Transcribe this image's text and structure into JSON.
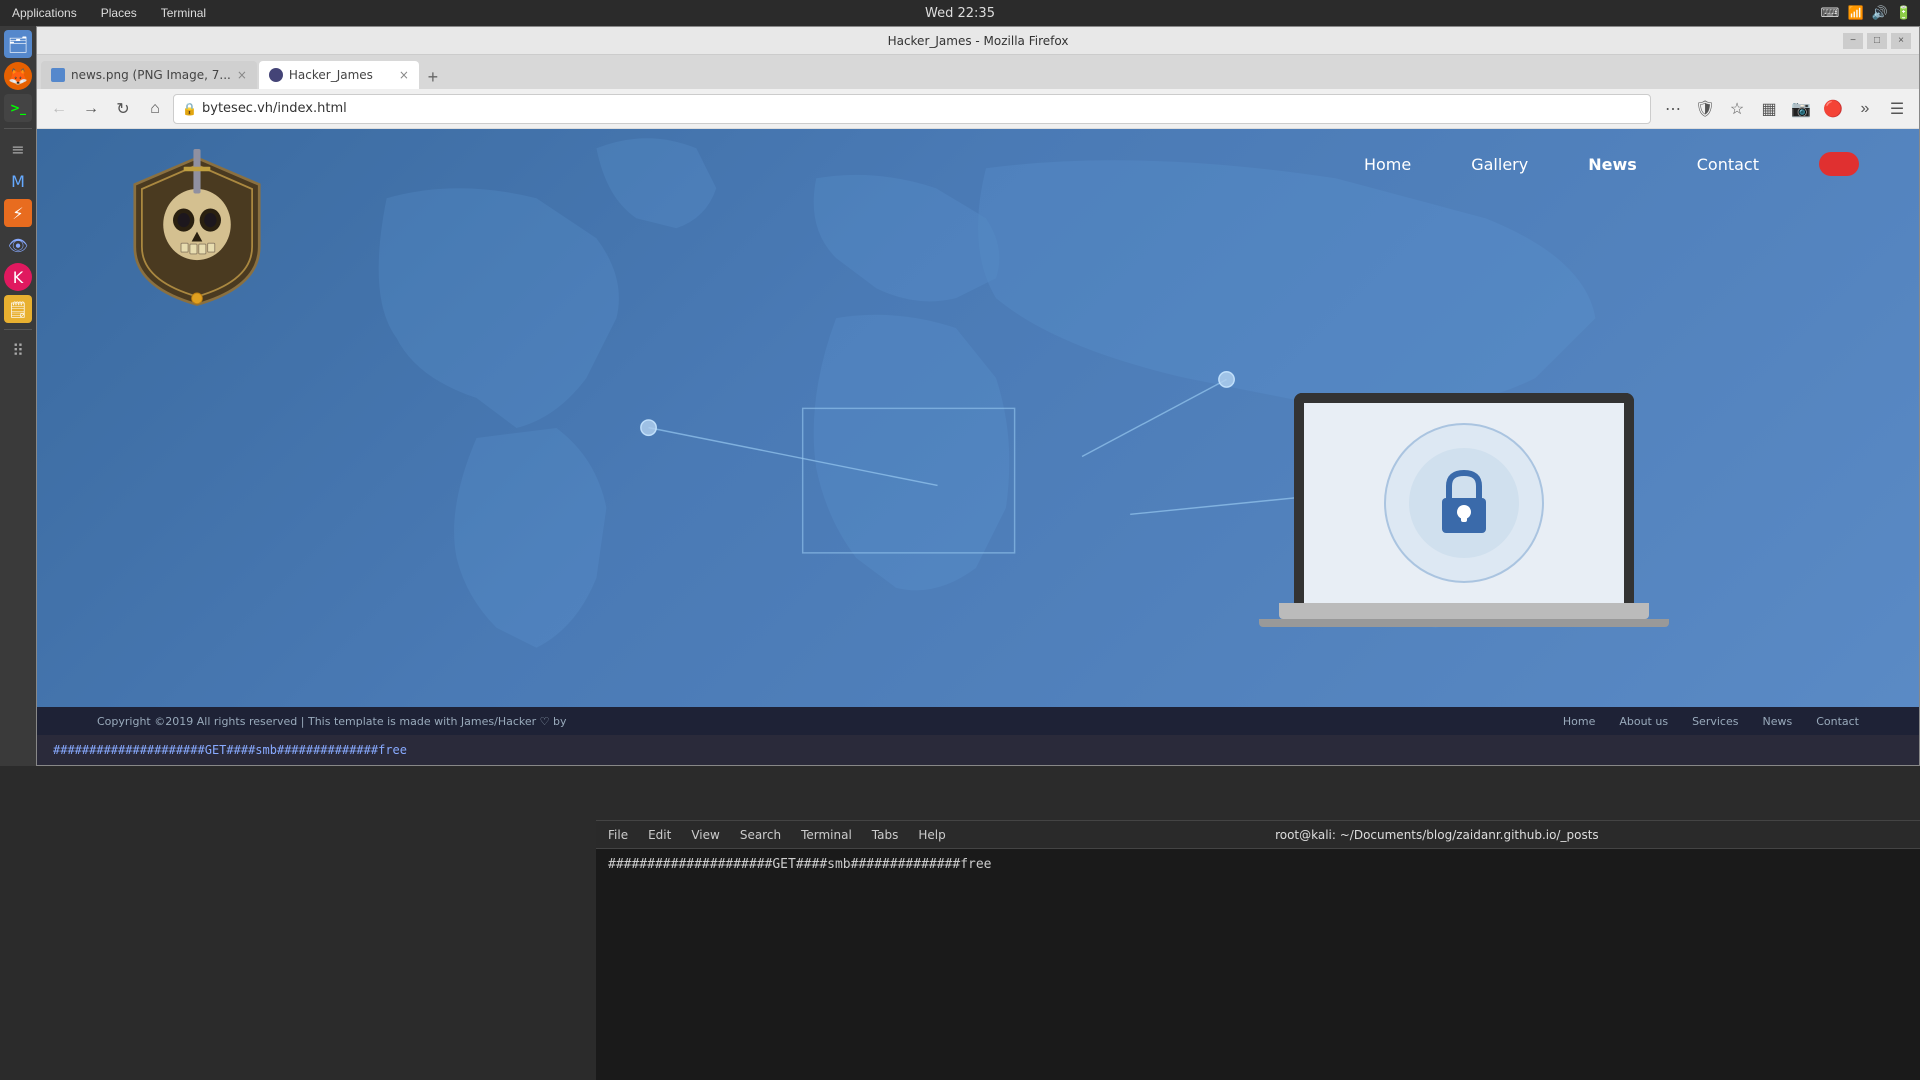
{
  "system": {
    "datetime": "Wed 22:35",
    "apps_label": "Applications",
    "places_label": "Places",
    "terminal_label": "Terminal"
  },
  "browser": {
    "title": "Hacker_James - Mozilla Firefox",
    "tabs": [
      {
        "id": "tab1",
        "label": "news.png (PNG Image, 7...",
        "type": "png",
        "active": false
      },
      {
        "id": "tab2",
        "label": "Hacker_James",
        "type": "hacker",
        "active": true
      }
    ],
    "url": "bytesec.vh/index.html",
    "window_controls": [
      "−",
      "□",
      "×"
    ]
  },
  "webpage": {
    "nav_items": [
      {
        "label": "Home",
        "active": false
      },
      {
        "label": "Gallery",
        "active": false
      },
      {
        "label": "News",
        "active": true
      },
      {
        "label": "Contact",
        "active": false
      }
    ],
    "footer": {
      "copyright": "Copyright ©2019 All rights reserved | This template is made with James/Hacker ♡ by",
      "links": [
        "Home",
        "About us",
        "Services",
        "News",
        "Contact"
      ]
    }
  },
  "terminal": {
    "title": "root@kali: ~/Documents/blog/zaidanr.github.io/_posts",
    "menu_items": [
      "File",
      "Edit",
      "View",
      "Search",
      "Terminal",
      "Tabs",
      "Help"
    ],
    "content": "#####################GET####smb##############free"
  },
  "taskbar": {
    "icons": [
      {
        "name": "files",
        "symbol": "🗂"
      },
      {
        "name": "firefox",
        "symbol": "🦊"
      },
      {
        "name": "terminal",
        "symbol": ">_"
      },
      {
        "name": "menu",
        "symbol": "≡"
      },
      {
        "name": "mail",
        "symbol": "M"
      },
      {
        "name": "burp",
        "symbol": "⚡"
      },
      {
        "name": "eye",
        "symbol": "👁"
      },
      {
        "name": "kali",
        "symbol": "K"
      },
      {
        "name": "notes",
        "symbol": "🗒"
      },
      {
        "name": "apps",
        "symbol": "⠿"
      }
    ]
  }
}
